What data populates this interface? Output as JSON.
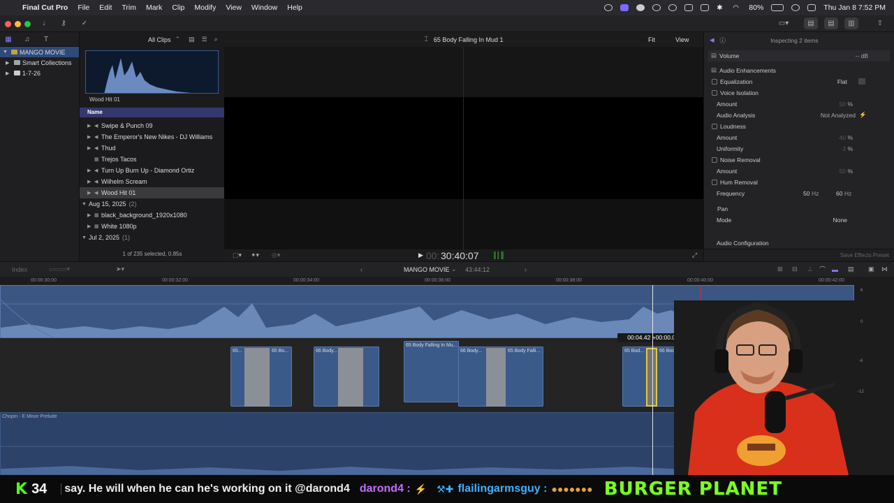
{
  "menubar": {
    "app": "Final Cut Pro",
    "items": [
      "File",
      "Edit",
      "Trim",
      "Mark",
      "Clip",
      "Modify",
      "View",
      "Window",
      "Help"
    ],
    "battery": "80%",
    "datetime": "Thu Jan 8  7:52 PM"
  },
  "library": {
    "name": "MANGO MOVIE",
    "items": [
      "Smart Collections",
      "1-7-26"
    ]
  },
  "browser": {
    "filter": "All Clips",
    "thumb_label": "Wood Hit 01",
    "name_header": "Name",
    "clips": [
      "Swipe & Punch 09",
      "The Emperor's New Nikes - DJ Williams",
      "Thud",
      "Trejos Tacos",
      "Turn Up Burn Up - Diamond Ortiz",
      "Wilhelm Scream",
      "Wood Hit 01"
    ],
    "group1": {
      "date": "Aug 15, 2025",
      "count": "(2)"
    },
    "group1_clips": [
      "black_background_1920x1080",
      "White 1080p"
    ],
    "group2": {
      "date": "Jul 2, 2025",
      "count": "(1)"
    },
    "footer": "1 of 235 selected, 0.85s"
  },
  "viewer": {
    "title": "65 Body Falling In Mud 1",
    "fit": "Fit",
    "view": "View",
    "timecode_dim": "00:",
    "timecode": "30:40:07"
  },
  "inspector": {
    "title": "Inspecting 2 items",
    "volume_label": "Volume",
    "volume_val": "-- dB",
    "enh": "Audio Enhancements",
    "eq": "Equalization",
    "eq_val": "Flat",
    "voice": "Voice Isolation",
    "amount": "Amount",
    "amt1": "50",
    "pct": "%",
    "analysis": "Audio Analysis",
    "analysis_val": "Not Analyzed",
    "loudness": "Loudness",
    "amt2": "40",
    "uniformity": "Uniformity",
    "uni": "3",
    "noise": "Noise Removal",
    "amt3": "50",
    "hum": "Hum Removal",
    "freq": "Frequency",
    "hz50": "50",
    "hz60": "60",
    "hz": "Hz",
    "pan": "Pan",
    "mode": "Mode",
    "mode_val": "None",
    "config": "Audio Configuration",
    "save": "Save Effects Preset"
  },
  "timeline": {
    "index": "Index",
    "project": "MANGO MOVIE",
    "duration": "43:44:12",
    "ticks": [
      "00:00:30:00",
      "00:00:32:00",
      "00:00:34:00",
      "00:00:36:00",
      "00:00:38:00",
      "00:00:40:00",
      "00:00:42:00"
    ],
    "tooltip": "00:04.42  +00:00.00",
    "music": "Chopin - E Minor Prelude",
    "clips": [
      "65...",
      "65 Bo...",
      "66 Body...",
      "65 Body Falling In Mu...",
      "66 Body...",
      "65 Body Falli...",
      "65 Bod...",
      "66 Body Fall..."
    ],
    "meter": [
      "6",
      "0",
      "-6",
      "-12"
    ]
  },
  "stream": {
    "kick_count": "34",
    "chat": "say. He will when he can he's working on it @darond4",
    "user1": "darond4 :",
    "user2": "flailingarmsguy :",
    "banner": "BURGER PLANET"
  },
  "colors": {
    "accent": "#3a5a8a",
    "banner": "#7dff1f",
    "user1": "#c66cff",
    "user2": "#3fb0ff"
  }
}
